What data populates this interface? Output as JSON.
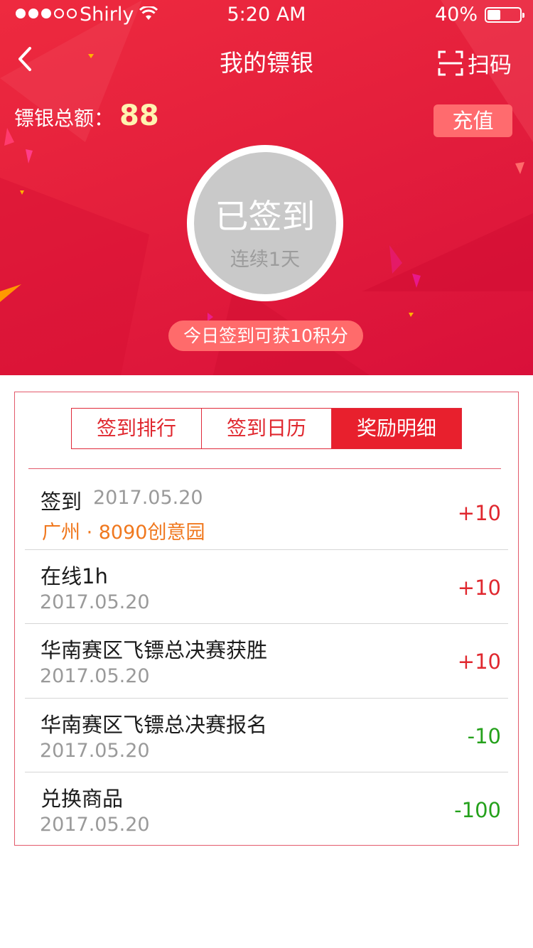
{
  "status_bar": {
    "carrier": "Shirly",
    "time": "5:20 AM",
    "battery_percent": "40%",
    "battery_level": 0.4,
    "signal_bars": 3,
    "signal_total": 5
  },
  "navbar": {
    "title": "我的镖银",
    "scan_label": "扫码"
  },
  "balance": {
    "label": "镖银总额：",
    "value": "88"
  },
  "recharge_label": "充值",
  "checkin": {
    "status": "已签到",
    "streak": "连续1天",
    "tip": "今日签到可获10积分"
  },
  "tabs": [
    {
      "label": "签到排行",
      "active": false
    },
    {
      "label": "签到日历",
      "active": false
    },
    {
      "label": "奖励明细",
      "active": true
    }
  ],
  "records": [
    {
      "title": "签到",
      "date": "2017.05.20",
      "location": "广州 · 8090创意园",
      "amount": "+10"
    },
    {
      "title": "在线1h",
      "date": "2017.05.20",
      "amount": "+10"
    },
    {
      "title": "华南赛区飞镖总决赛获胜",
      "date": "2017.05.20",
      "amount": "+10"
    },
    {
      "title": "华南赛区飞镖总决赛报名",
      "date": "2017.05.20",
      "amount": "-10"
    },
    {
      "title": "兑换商品",
      "date": "2017.05.20",
      "amount": "-100"
    }
  ],
  "colors": {
    "brand_red": "#e41f3c",
    "positive": "#e0282f",
    "negative": "#25a11c",
    "location": "#f0781e",
    "signed_gray": "#c9c9c9"
  }
}
